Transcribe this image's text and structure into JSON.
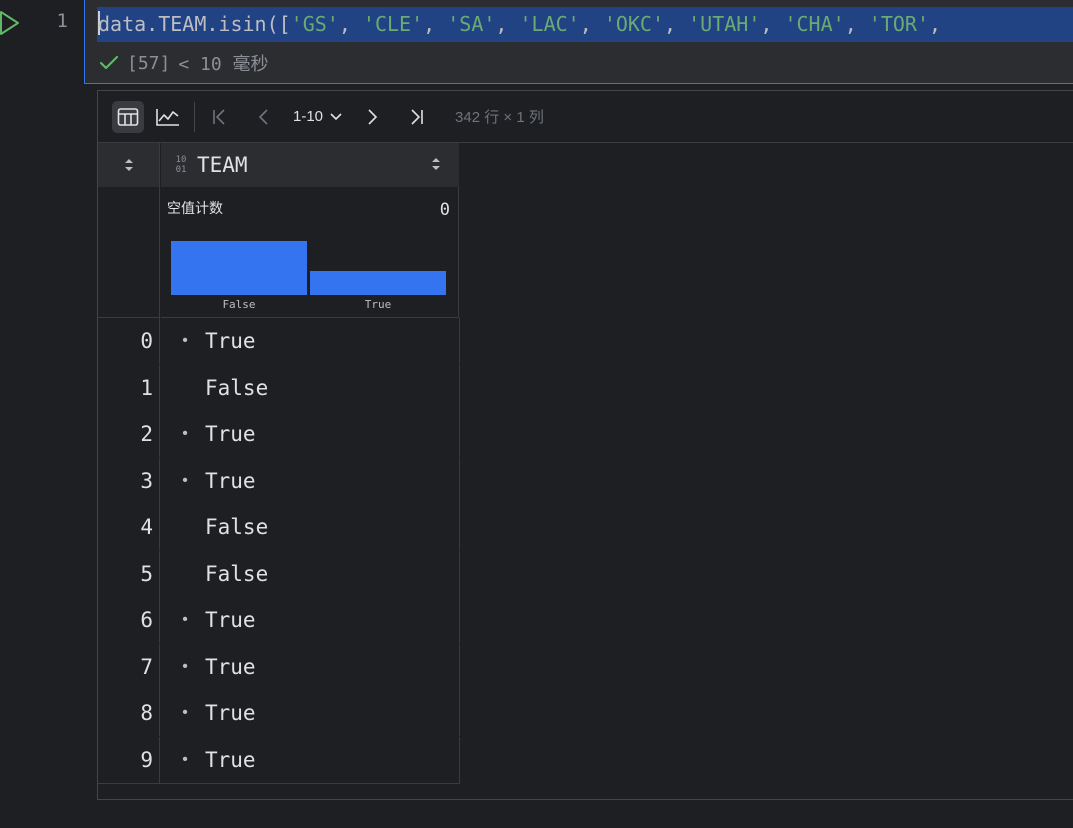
{
  "editor": {
    "line_number": "1",
    "code": [
      {
        "t": "data.TEAM.isin([",
        "c": ""
      },
      {
        "t": "'GS'",
        "c": "str"
      },
      {
        "t": ", ",
        "c": ""
      },
      {
        "t": "'CLE'",
        "c": "str"
      },
      {
        "t": ", ",
        "c": ""
      },
      {
        "t": "'SA'",
        "c": "str"
      },
      {
        "t": ", ",
        "c": ""
      },
      {
        "t": "'LAC'",
        "c": "str"
      },
      {
        "t": ", ",
        "c": ""
      },
      {
        "t": "'OKC'",
        "c": "str"
      },
      {
        "t": ", ",
        "c": ""
      },
      {
        "t": "'UTAH'",
        "c": "str"
      },
      {
        "t": ", ",
        "c": ""
      },
      {
        "t": "'CHA'",
        "c": "str"
      },
      {
        "t": ", ",
        "c": ""
      },
      {
        "t": "'TOR'",
        "c": "str"
      },
      {
        "t": ", ",
        "c": ""
      }
    ],
    "exec_count": "[57]",
    "exec_time": "< 10 毫秒"
  },
  "toolbar": {
    "page_range": "1-10",
    "dimensions": "342 行 × 1 列"
  },
  "table": {
    "column": {
      "type_icon": [
        "10",
        "01"
      ],
      "name": "TEAM"
    },
    "stats": {
      "null_label": "空值计数",
      "null_count": "0",
      "histogram": {
        "categories": [
          "False",
          "True"
        ],
        "values": [
          0.69,
          0.31
        ]
      }
    },
    "rows": [
      {
        "index": "0",
        "value": "True"
      },
      {
        "index": "1",
        "value": "False"
      },
      {
        "index": "2",
        "value": "True"
      },
      {
        "index": "3",
        "value": "True"
      },
      {
        "index": "4",
        "value": "False"
      },
      {
        "index": "5",
        "value": "False"
      },
      {
        "index": "6",
        "value": "True"
      },
      {
        "index": "7",
        "value": "True"
      },
      {
        "index": "8",
        "value": "True"
      },
      {
        "index": "9",
        "value": "True"
      }
    ]
  },
  "colors": {
    "accent": "#3574f0",
    "selection": "#214283",
    "string": "#6aab73",
    "success": "#5fb865"
  }
}
